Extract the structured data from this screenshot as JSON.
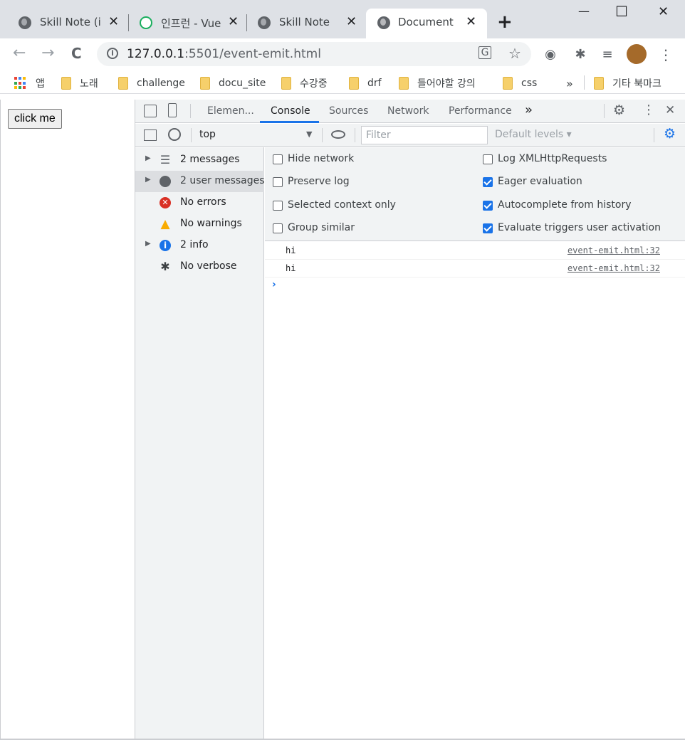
{
  "tabs": [
    {
      "title": "Skill Note (in",
      "icon": "globe-icon"
    },
    {
      "title": "인프런 - Vue",
      "icon": "inflearn-icon"
    },
    {
      "title": "Skill Note",
      "icon": "globe-icon"
    },
    {
      "title": "Document",
      "icon": "globe-icon",
      "active": true
    }
  ],
  "tab_close_glyph": "✕",
  "new_tab_glyph": "+",
  "window": {
    "minimize": "—",
    "maximize": "☐",
    "close": "✕"
  },
  "toolbar": {
    "back": "←",
    "forward": "→",
    "reload": "C",
    "url_host": "127.0.0.1",
    "url_rest": ":5501/event-emit.html",
    "info": "i",
    "more": "⋮"
  },
  "bookmarks": {
    "apps": "앱",
    "items": [
      "노래",
      "challenge",
      "docu_site",
      "수강중",
      "drf",
      "들어야할 강의",
      "css"
    ],
    "overflow": "»",
    "other": "기타 북마크"
  },
  "page": {
    "button_label": "click me"
  },
  "devtools": {
    "tabs": [
      "Elemen...",
      "Console",
      "Sources",
      "Network",
      "Performance"
    ],
    "tabs_overflow": "»",
    "context": "top",
    "filter_placeholder": "Filter",
    "levels": "Default levels ▾",
    "sidebar": [
      {
        "label": "2 messages",
        "icon": "list-icon",
        "expandable": true
      },
      {
        "label": "2 user messages",
        "icon": "user-icon",
        "expandable": true,
        "selected": true
      },
      {
        "label": "No errors",
        "icon": "error-icon",
        "expandable": false
      },
      {
        "label": "No warnings",
        "icon": "warning-icon",
        "expandable": false
      },
      {
        "label": "2 info",
        "icon": "info-icon",
        "expandable": true
      },
      {
        "label": "No verbose",
        "icon": "bug-icon",
        "expandable": false
      }
    ],
    "settings": {
      "hide_network": {
        "label": "Hide network",
        "checked": false
      },
      "preserve_log": {
        "label": "Preserve log",
        "checked": false
      },
      "selected_context": {
        "label": "Selected context only",
        "checked": false
      },
      "group_similar": {
        "label": "Group similar",
        "checked": false
      },
      "log_xhr": {
        "label": "Log XMLHttpRequests",
        "checked": false
      },
      "eager_eval": {
        "label": "Eager evaluation",
        "checked": true
      },
      "autocomplete": {
        "label": "Autocomplete from history",
        "checked": true
      },
      "eval_triggers": {
        "label": "Evaluate triggers user activation",
        "checked": true
      }
    },
    "log": [
      {
        "message": "hi",
        "source": "event-emit.html:32"
      },
      {
        "message": "hi",
        "source": "event-emit.html:32"
      }
    ],
    "prompt": "›"
  },
  "colors": {
    "accent": "#1a73e8",
    "error": "#d93025",
    "warning": "#f9ab00",
    "info": "#1a73e8",
    "tabstrip": "#dee1e6"
  }
}
